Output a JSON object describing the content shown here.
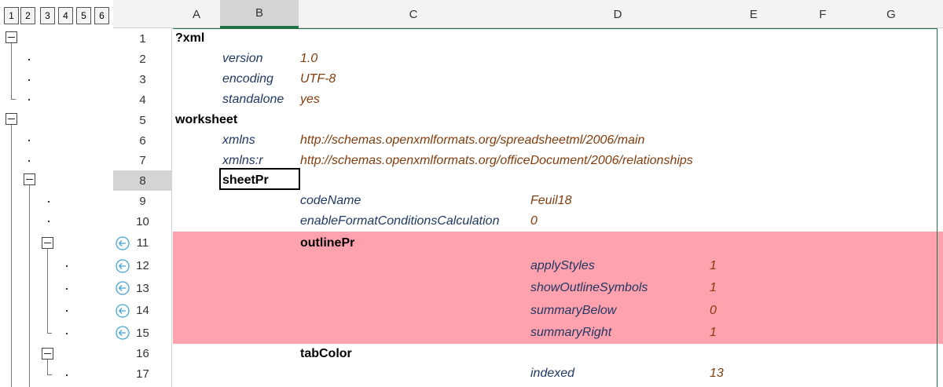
{
  "outline_levels": [
    "1",
    "2",
    "3",
    "4",
    "5",
    "6"
  ],
  "columns": [
    {
      "id": "A",
      "label": "A"
    },
    {
      "id": "B",
      "label": "B"
    },
    {
      "id": "C",
      "label": "C"
    },
    {
      "id": "D",
      "label": "D"
    },
    {
      "id": "E",
      "label": "E"
    },
    {
      "id": "F",
      "label": "F"
    },
    {
      "id": "G",
      "label": "G"
    }
  ],
  "selected_column": "B",
  "selected_row": "8",
  "highlight_color": "#ffa2ae",
  "rows": [
    {
      "num": "1",
      "cells": [
        {
          "col": "A",
          "text": "?xml",
          "kind": "tag"
        }
      ]
    },
    {
      "num": "2",
      "cells": [
        {
          "col": "B",
          "text": "version",
          "kind": "attr"
        },
        {
          "col": "C",
          "text": "1.0",
          "kind": "val"
        }
      ]
    },
    {
      "num": "3",
      "cells": [
        {
          "col": "B",
          "text": "encoding",
          "kind": "attr"
        },
        {
          "col": "C",
          "text": "UTF-8",
          "kind": "val"
        }
      ]
    },
    {
      "num": "4",
      "cells": [
        {
          "col": "B",
          "text": "standalone",
          "kind": "attr"
        },
        {
          "col": "C",
          "text": "yes",
          "kind": "val"
        }
      ]
    },
    {
      "num": "5",
      "cells": [
        {
          "col": "A",
          "text": "worksheet",
          "kind": "tag"
        }
      ]
    },
    {
      "num": "6",
      "cells": [
        {
          "col": "B",
          "text": "xmlns",
          "kind": "attr"
        },
        {
          "col": "C",
          "text": "http://schemas.openxmlformats.org/spreadsheetml/2006/main",
          "kind": "val"
        }
      ]
    },
    {
      "num": "7",
      "cells": [
        {
          "col": "B",
          "text": "xmlns:r",
          "kind": "attr"
        },
        {
          "col": "C",
          "text": "http://schemas.openxmlformats.org/officeDocument/2006/relationships",
          "kind": "val"
        }
      ]
    },
    {
      "num": "8",
      "cells": [
        {
          "col": "B",
          "text": "sheetPr",
          "kind": "tag"
        }
      ]
    },
    {
      "num": "9",
      "cells": [
        {
          "col": "C",
          "text": "codeName",
          "kind": "attr"
        },
        {
          "col": "D",
          "text": "Feuil18",
          "kind": "val"
        }
      ]
    },
    {
      "num": "10",
      "cells": [
        {
          "col": "C",
          "text": "enableFormatConditionsCalculation",
          "kind": "attr"
        },
        {
          "col": "D",
          "text": "0",
          "kind": "val"
        }
      ]
    },
    {
      "num": "11",
      "highlight": true,
      "cells": [
        {
          "col": "C",
          "text": "outlinePr",
          "kind": "tag"
        }
      ]
    },
    {
      "num": "12",
      "highlight": true,
      "cells": [
        {
          "col": "D",
          "text": "applyStyles",
          "kind": "attr"
        },
        {
          "col": "E",
          "text": "1",
          "kind": "val"
        }
      ]
    },
    {
      "num": "13",
      "highlight": true,
      "cells": [
        {
          "col": "D",
          "text": "showOutlineSymbols",
          "kind": "attr"
        },
        {
          "col": "E",
          "text": "1",
          "kind": "val"
        }
      ]
    },
    {
      "num": "14",
      "highlight": true,
      "cells": [
        {
          "col": "D",
          "text": "summaryBelow",
          "kind": "attr"
        },
        {
          "col": "E",
          "text": "0",
          "kind": "val"
        }
      ]
    },
    {
      "num": "15",
      "highlight": true,
      "cells": [
        {
          "col": "D",
          "text": "summaryRight",
          "kind": "attr"
        },
        {
          "col": "E",
          "text": "1",
          "kind": "val"
        }
      ]
    },
    {
      "num": "16",
      "cells": [
        {
          "col": "C",
          "text": "tabColor",
          "kind": "tag"
        }
      ]
    },
    {
      "num": "17",
      "cells": [
        {
          "col": "D",
          "text": "indexed",
          "kind": "attr"
        },
        {
          "col": "E",
          "text": "13",
          "kind": "val"
        }
      ]
    }
  ],
  "icons": {
    "collapse": "minus-box-icon",
    "trace": "arrow-left-circle-icon"
  }
}
